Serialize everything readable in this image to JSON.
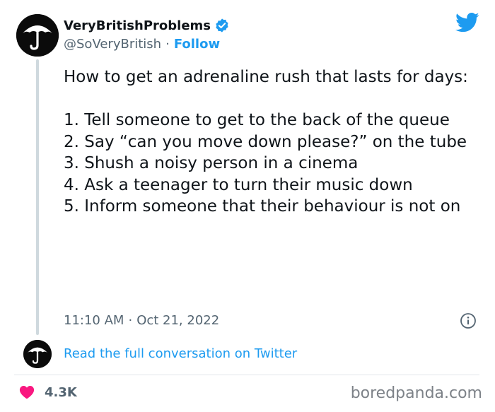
{
  "author": {
    "display_name": "VeryBritishProblems",
    "handle": "@SoVeryBritish",
    "separator": "·",
    "follow_label": "Follow",
    "avatar_icon": "umbrella-icon",
    "verified": true
  },
  "tweet": {
    "intro": "How to get an adrenaline rush that lasts for days:",
    "items": [
      "1. Tell someone to get to the back of the queue",
      "2. Say “can you move down please?” on the tube",
      "3. Shush a noisy person in a cinema",
      "4. Ask a teenager to turn their music down",
      "5. Inform someone that their behaviour is not on"
    ],
    "time": "11:10 AM",
    "separator": "·",
    "date": "Oct 21, 2022"
  },
  "footer": {
    "read_full_label": "Read the full conversation on Twitter",
    "likes": "4.3K",
    "watermark": "boredpanda.com"
  },
  "colors": {
    "accent": "#1d9bf0",
    "text": "#0f1419",
    "muted": "#536471",
    "heart": "#f91880"
  }
}
